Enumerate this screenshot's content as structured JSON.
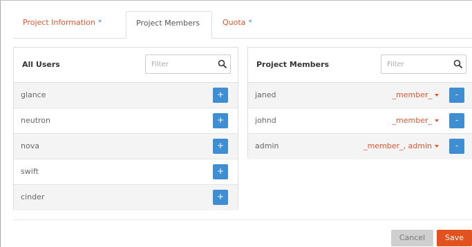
{
  "tabs": [
    {
      "label": "Project Information",
      "required": "*"
    },
    {
      "label": "Project Members",
      "required": ""
    },
    {
      "label": "Quota",
      "required": "*"
    }
  ],
  "all_users": {
    "title": "All Users",
    "filter_placeholder": "Filter",
    "add_label": "+",
    "items": [
      "glance",
      "neutron",
      "nova",
      "swift",
      "cinder"
    ]
  },
  "project_members": {
    "title": "Project Members",
    "filter_placeholder": "Filter",
    "remove_label": "-",
    "items": [
      {
        "name": "janed",
        "role": "_member_"
      },
      {
        "name": "johnd",
        "role": "_member_"
      },
      {
        "name": "admin",
        "role": "_member_, admin"
      }
    ]
  },
  "footer": {
    "cancel_label": "Cancel",
    "save_label": "Save"
  },
  "colors": {
    "accent": "#e8542e",
    "button_blue": "#3f8ed1",
    "save": "#e2521e"
  },
  "icons": {
    "filter": "search-icon",
    "dropdown": "caret-down-icon"
  }
}
